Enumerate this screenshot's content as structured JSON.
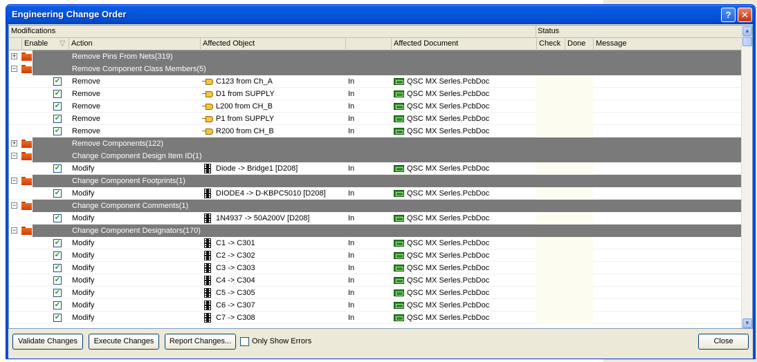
{
  "window": {
    "title": "Engineering Change Order",
    "help_glyph": "?",
    "close_glyph": "✕"
  },
  "header": {
    "section_modifications": "Modifications",
    "section_status": "Status",
    "columns": {
      "enable": "Enable",
      "action": "Action",
      "affected_object": "Affected Object",
      "affected_document": "Affected Document",
      "check": "Check",
      "done": "Done",
      "message": "Message"
    }
  },
  "rows": [
    {
      "type": "group",
      "expander": "+",
      "label": "Remove Pins From Nets(319)"
    },
    {
      "type": "group",
      "expander": "−",
      "label": "Remove Component Class Members(5)"
    },
    {
      "type": "item",
      "checked": "✔",
      "action": "Remove",
      "icon": "net-class-icon",
      "object": "C123 from Ch_A",
      "dir": "In",
      "document": "QSC MX Serles.PcbDoc"
    },
    {
      "type": "item",
      "checked": "✔",
      "action": "Remove",
      "icon": "net-class-icon",
      "object": "D1 from SUPPLY",
      "dir": "In",
      "document": "QSC MX Serles.PcbDoc"
    },
    {
      "type": "item",
      "checked": "✔",
      "action": "Remove",
      "icon": "net-class-icon",
      "object": "L200 from CH_B",
      "dir": "In",
      "document": "QSC MX Serles.PcbDoc"
    },
    {
      "type": "item",
      "checked": "✔",
      "action": "Remove",
      "icon": "net-class-icon",
      "object": "P1 from SUPPLY",
      "dir": "In",
      "document": "QSC MX Serles.PcbDoc"
    },
    {
      "type": "item",
      "checked": "✔",
      "action": "Remove",
      "icon": "net-class-icon",
      "object": "R200 from CH_B",
      "dir": "In",
      "document": "QSC MX Serles.PcbDoc"
    },
    {
      "type": "group",
      "expander": "+",
      "label": "Remove Components(122)"
    },
    {
      "type": "group",
      "expander": "−",
      "label": "Change Component Design Item ID(1)"
    },
    {
      "type": "item",
      "checked": "✔",
      "action": "Modify",
      "icon": "component-icon",
      "object": "Diode -> Bridge1 [D208]",
      "dir": "In",
      "document": "QSC MX Serles.PcbDoc"
    },
    {
      "type": "group",
      "expander": "−",
      "label": "Change Component Footprints(1)"
    },
    {
      "type": "item",
      "checked": "✔",
      "action": "Modify",
      "icon": "component-icon",
      "object": "DIODE4 -> D-KBPC5010 [D208]",
      "dir": "In",
      "document": "QSC MX Serles.PcbDoc"
    },
    {
      "type": "group",
      "expander": "−",
      "label": "Change Component Comments(1)"
    },
    {
      "type": "item",
      "checked": "✔",
      "action": "Modify",
      "icon": "component-icon",
      "object": "1N4937 -> 50A200V [D208]",
      "dir": "In",
      "document": "QSC MX Serles.PcbDoc"
    },
    {
      "type": "group",
      "expander": "−",
      "label": "Change Component Designators(170)"
    },
    {
      "type": "item",
      "checked": "✔",
      "action": "Modify",
      "icon": "component-icon",
      "object": "C1 -> C301",
      "dir": "In",
      "document": "QSC MX Serles.PcbDoc"
    },
    {
      "type": "item",
      "checked": "✔",
      "action": "Modify",
      "icon": "component-icon",
      "object": "C2 -> C302",
      "dir": "In",
      "document": "QSC MX Serles.PcbDoc"
    },
    {
      "type": "item",
      "checked": "✔",
      "action": "Modify",
      "icon": "component-icon",
      "object": "C3 -> C303",
      "dir": "In",
      "document": "QSC MX Serles.PcbDoc"
    },
    {
      "type": "item",
      "checked": "✔",
      "action": "Modify",
      "icon": "component-icon",
      "object": "C4 -> C304",
      "dir": "In",
      "document": "QSC MX Serles.PcbDoc"
    },
    {
      "type": "item",
      "checked": "✔",
      "action": "Modify",
      "icon": "component-icon",
      "object": "C5 -> C305",
      "dir": "In",
      "document": "QSC MX Serles.PcbDoc"
    },
    {
      "type": "item",
      "checked": "✔",
      "action": "Modify",
      "icon": "component-icon",
      "object": "C6 -> C307",
      "dir": "In",
      "document": "QSC MX Serles.PcbDoc"
    },
    {
      "type": "item",
      "checked": "✔",
      "action": "Modify",
      "icon": "component-icon",
      "object": "C7 -> C308",
      "dir": "In",
      "document": "QSC MX Serles.PcbDoc"
    }
  ],
  "footer": {
    "validate": "Validate Changes",
    "execute": "Execute Changes",
    "report": "Report Changes...",
    "only_errors": "Only Show Errors",
    "close": "Close"
  },
  "scroll": {
    "up": "▲",
    "down": "▼"
  },
  "colors": {
    "title_bar": "#0455dd",
    "group_row": "#7a7a7a",
    "status_column": "#fcfcf0",
    "folder": "#f06a1c"
  }
}
